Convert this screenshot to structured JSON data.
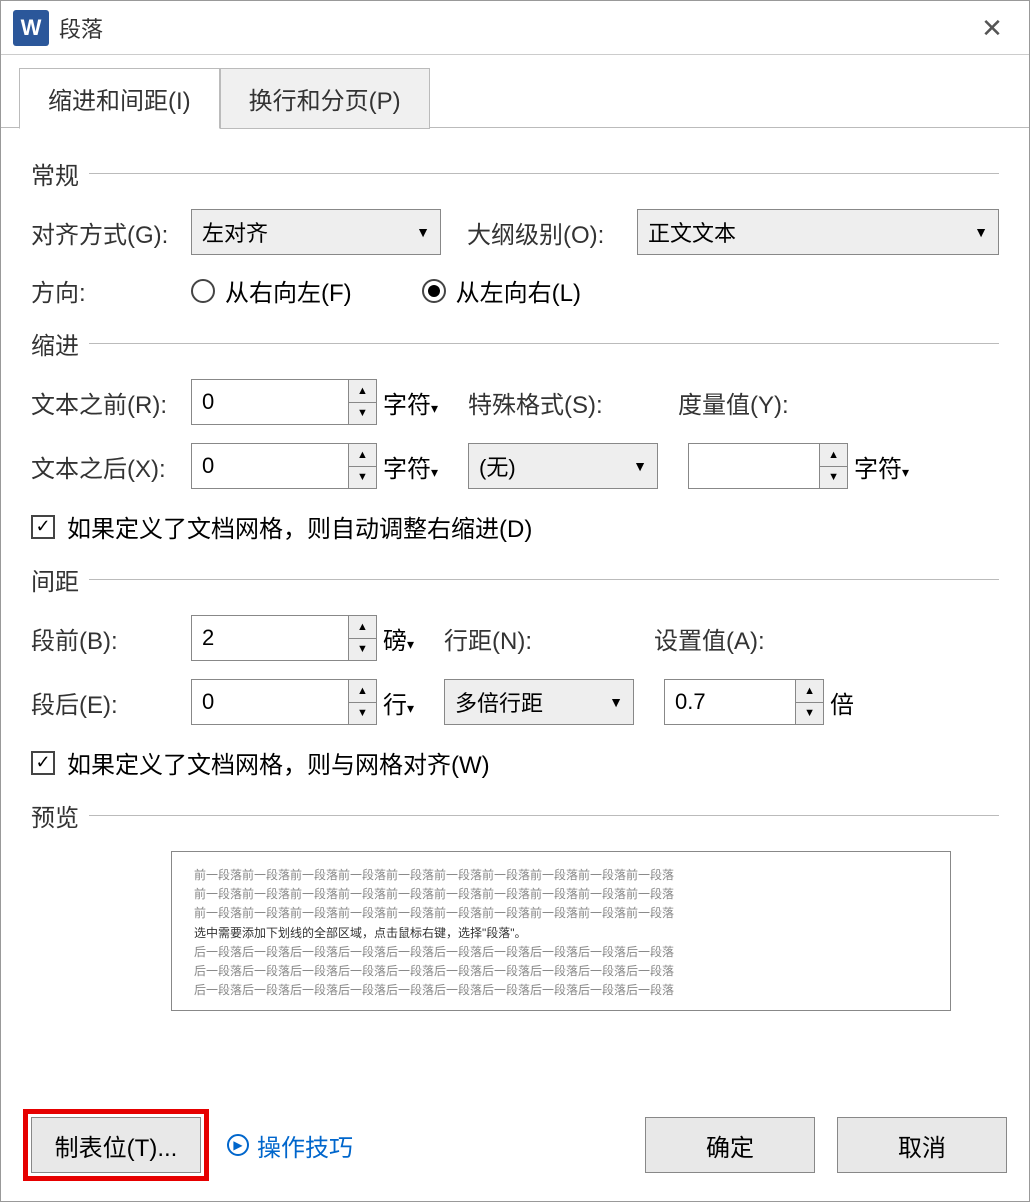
{
  "titlebar": {
    "title": "段落"
  },
  "tabs": [
    {
      "label": "缩进和间距(I)",
      "active": true
    },
    {
      "label": "换行和分页(P)",
      "active": false
    }
  ],
  "general": {
    "title": "常规",
    "align_label": "对齐方式(G):",
    "align_value": "左对齐",
    "outline_label": "大纲级别(O):",
    "outline_value": "正文文本",
    "direction_label": "方向:",
    "rtl_label": "从右向左(F)",
    "ltr_label": "从左向右(L)"
  },
  "indent": {
    "title": "缩进",
    "before_label": "文本之前(R):",
    "before_value": "0",
    "after_label": "文本之后(X):",
    "after_value": "0",
    "unit_char": "字符",
    "special_label": "特殊格式(S):",
    "special_value": "(无)",
    "measure_label": "度量值(Y):",
    "measure_value": "",
    "measure_unit": "字符",
    "check_label": "如果定义了文档网格，则自动调整右缩进(D)"
  },
  "spacing": {
    "title": "间距",
    "before_label": "段前(B):",
    "before_value": "2",
    "before_unit": "磅",
    "after_label": "段后(E):",
    "after_value": "0",
    "after_unit": "行",
    "line_label": "行距(N):",
    "line_value": "多倍行距",
    "set_label": "设置值(A):",
    "set_value": "0.7",
    "set_unit": "倍",
    "check_label": "如果定义了文档网格，则与网格对齐(W)"
  },
  "preview": {
    "title": "预览",
    "gray_line": "前一段落前一段落前一段落前一段落前一段落前一段落前一段落前一段落前一段落前一段落",
    "mid_line": "选中需要添加下划线的全部区域，点击鼠标右键，选择\"段落\"。",
    "gray_after": "后一段落后一段落后一段落后一段落后一段落后一段落后一段落后一段落后一段落后一段落"
  },
  "footer": {
    "tabs_btn": "制表位(T)...",
    "tips": "操作技巧",
    "ok": "确定",
    "cancel": "取消"
  }
}
